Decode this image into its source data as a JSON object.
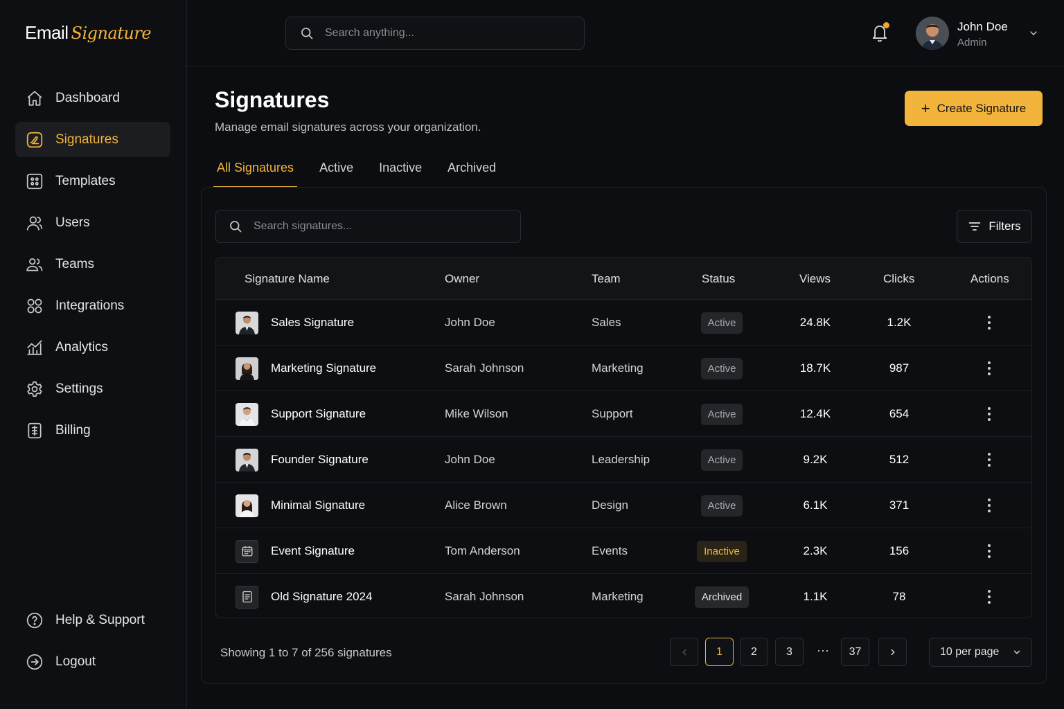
{
  "brand": {
    "word1": "Email",
    "word2": "Signature",
    "accent": "#f3b43c"
  },
  "sidebar": {
    "items": [
      {
        "label": "Dashboard",
        "icon": "home-icon"
      },
      {
        "label": "Signatures",
        "icon": "signature-icon",
        "active": true
      },
      {
        "label": "Templates",
        "icon": "templates-icon"
      },
      {
        "label": "Users",
        "icon": "user-icon"
      },
      {
        "label": "Teams",
        "icon": "teams-icon"
      },
      {
        "label": "Integrations",
        "icon": "integrations-icon"
      },
      {
        "label": "Analytics",
        "icon": "analytics-icon"
      },
      {
        "label": "Settings",
        "icon": "gear-icon"
      },
      {
        "label": "Billing",
        "icon": "billing-icon"
      }
    ],
    "bottom": [
      {
        "label": "Help & Support",
        "icon": "help-icon"
      },
      {
        "label": "Logout",
        "icon": "logout-icon"
      }
    ]
  },
  "topbar": {
    "search_placeholder": "Search anything...",
    "user": {
      "name": "John Doe",
      "role": "Admin"
    }
  },
  "page": {
    "title": "Signatures",
    "subtitle": "Manage email signatures across your organization.",
    "create_label": "Create Signature"
  },
  "tabs": [
    "All Signatures",
    "Active",
    "Inactive",
    "Archived"
  ],
  "table": {
    "search_placeholder": "Search signatures...",
    "filters_label": "Filters",
    "columns": [
      "Signature Name",
      "Owner",
      "Team",
      "Status",
      "Views",
      "Clicks",
      "Actions"
    ],
    "rows": [
      {
        "name": "Sales Signature",
        "owner": "John Doe",
        "team": "Sales",
        "status": "Active",
        "views": "24.8K",
        "clicks": "1.2K",
        "thumb": "man-suit"
      },
      {
        "name": "Marketing Signature",
        "owner": "Sarah Johnson",
        "team": "Marketing",
        "status": "Active",
        "views": "18.7K",
        "clicks": "987",
        "thumb": "woman-dark"
      },
      {
        "name": "Support Signature",
        "owner": "Mike Wilson",
        "team": "Support",
        "status": "Active",
        "views": "12.4K",
        "clicks": "654",
        "thumb": "man-light"
      },
      {
        "name": "Founder Signature",
        "owner": "John Doe",
        "team": "Leadership",
        "status": "Active",
        "views": "9.2K",
        "clicks": "512",
        "thumb": "man-suit"
      },
      {
        "name": "Minimal Signature",
        "owner": "Alice Brown",
        "team": "Design",
        "status": "Active",
        "views": "6.1K",
        "clicks": "371",
        "thumb": "woman-light"
      },
      {
        "name": "Event Signature",
        "owner": "Tom Anderson",
        "team": "Events",
        "status": "Inactive",
        "views": "2.3K",
        "clicks": "156",
        "thumb": "calendar-icon"
      },
      {
        "name": "Old Signature 2024",
        "owner": "Sarah Johnson",
        "team": "Marketing",
        "status": "Archived",
        "views": "1.1K",
        "clicks": "78",
        "thumb": "document-icon"
      }
    ]
  },
  "footer": {
    "showing": "Showing 1 to 7 of 256 signatures",
    "pages": [
      "1",
      "2",
      "3",
      "37"
    ],
    "ellipsis": "···",
    "current_page": "1",
    "per_page": "10 per page"
  }
}
